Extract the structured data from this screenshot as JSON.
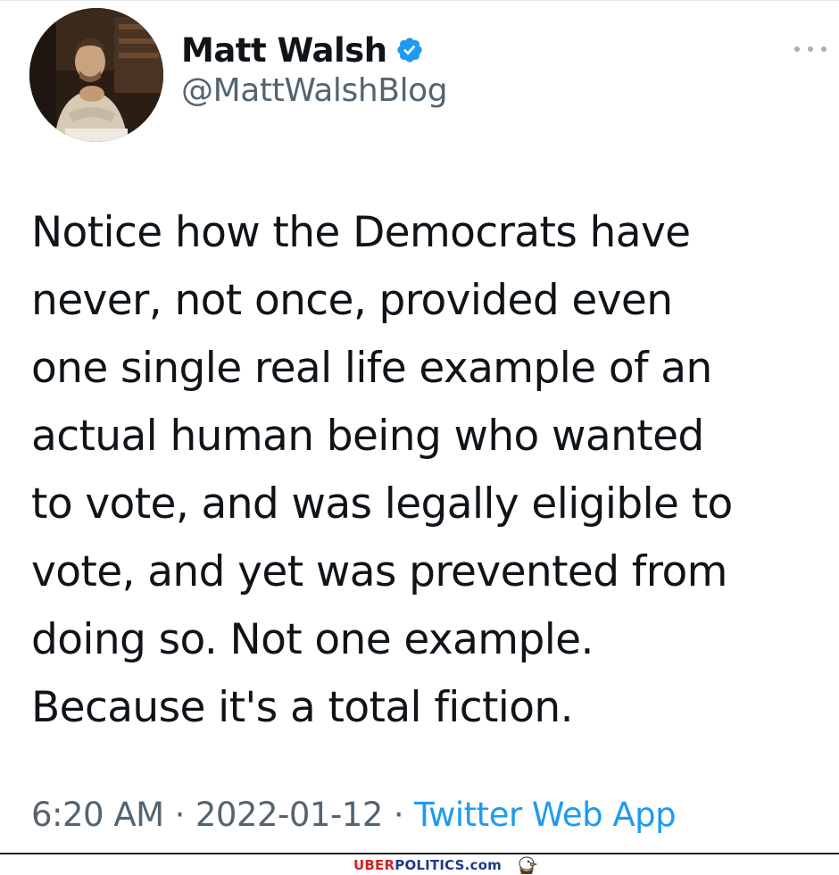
{
  "tweet": {
    "author": {
      "display_name": "Matt Walsh",
      "handle": "@MattWalshBlog",
      "verified": true
    },
    "text": "Notice how the Democrats have\nnever, not once, provided even\none single real life example of an\nactual human being who wanted\nto vote, and was legally eligible to\nvote, and yet was prevented from\ndoing so. Not one example.\nBecause it's a total fiction.",
    "time": "6:20 AM",
    "separator": "·",
    "date": "2022-01-12",
    "source": "Twitter Web App"
  },
  "watermark": {
    "part1": "UBER",
    "part2": "POLITICS.com",
    "icon": "eagle-icon"
  },
  "icons": {
    "verified": "verified-badge-icon",
    "more": "more-options-icon"
  },
  "colors": {
    "text": "#0f1419",
    "secondary": "#536471",
    "link": "#1d9bf0",
    "verified": "#1d9bf0",
    "watermark_red": "#d42020",
    "watermark_blue": "#1f3a8a"
  }
}
